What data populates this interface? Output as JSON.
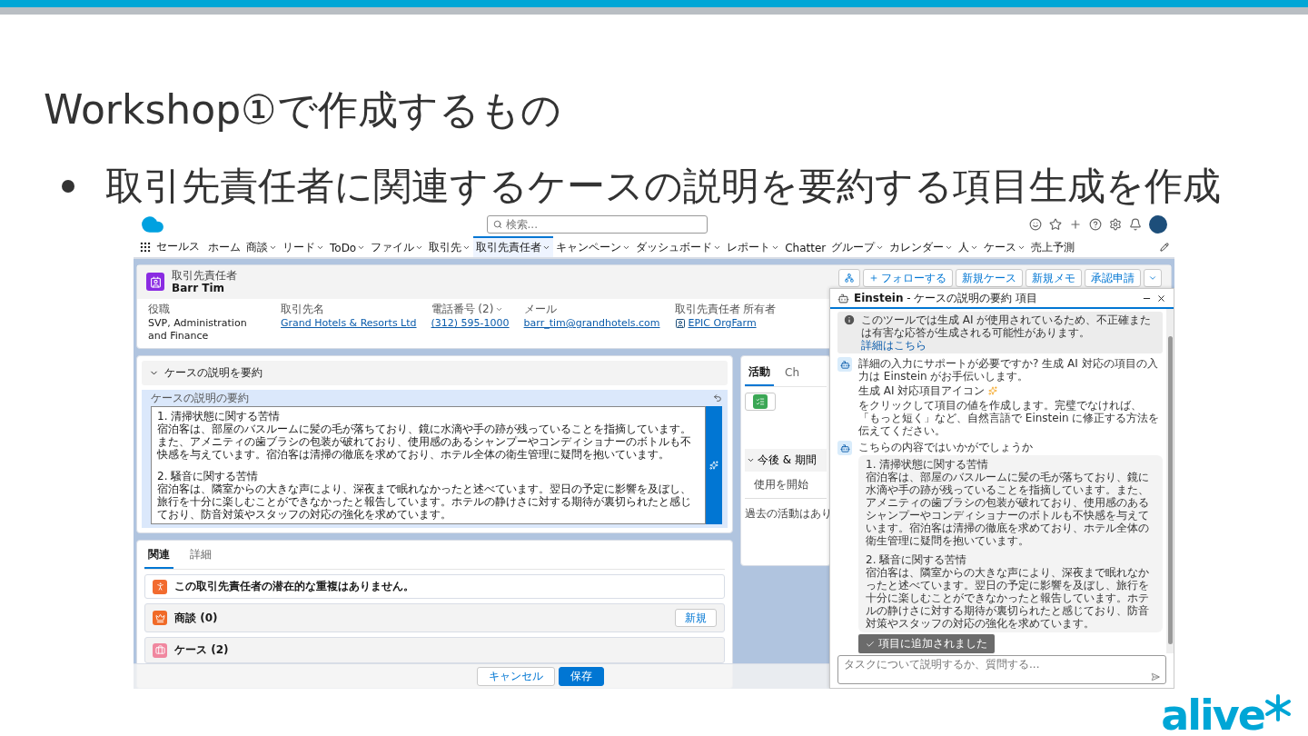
{
  "slide": {
    "title": "Workshop①で作成するもの",
    "bullets": [
      "取引先責任者に関連するケースの説明を要約する項目生成を作成"
    ],
    "logo": {
      "text": "alive"
    }
  },
  "app": {
    "search": {
      "placeholder": "検索..."
    },
    "app_name": "セールス",
    "nav": [
      {
        "label": "ホーム",
        "dropdown": false,
        "selected": false
      },
      {
        "label": "商談",
        "dropdown": true,
        "selected": false
      },
      {
        "label": "リード",
        "dropdown": true,
        "selected": false
      },
      {
        "label": "ToDo",
        "dropdown": true,
        "selected": false
      },
      {
        "label": "ファイル",
        "dropdown": true,
        "selected": false
      },
      {
        "label": "取引先",
        "dropdown": true,
        "selected": false
      },
      {
        "label": "取引先責任者",
        "dropdown": true,
        "selected": true
      },
      {
        "label": "キャンペーン",
        "dropdown": true,
        "selected": false
      },
      {
        "label": "ダッシュボード",
        "dropdown": true,
        "selected": false
      },
      {
        "label": "レポート",
        "dropdown": true,
        "selected": false
      },
      {
        "label": "Chatter",
        "dropdown": false,
        "selected": false
      },
      {
        "label": "グループ",
        "dropdown": true,
        "selected": false
      },
      {
        "label": "カレンダー",
        "dropdown": true,
        "selected": false
      },
      {
        "label": "人",
        "dropdown": true,
        "selected": false
      },
      {
        "label": "ケース",
        "dropdown": true,
        "selected": false
      },
      {
        "label": "売上予測",
        "dropdown": false,
        "selected": false
      }
    ],
    "record": {
      "type": "取引先責任者",
      "name": "Barr Tim",
      "follow": "フォローする",
      "actions": [
        "新規ケース",
        "新規メモ",
        "承認申請"
      ],
      "fields": [
        {
          "label": "役職",
          "value": "SVP, Administration and Finance",
          "kind": "text"
        },
        {
          "label": "取引先名",
          "value": "Grand Hotels & Resorts Ltd",
          "kind": "link"
        },
        {
          "label": "電話番号 (2)",
          "value": "(312) 595-1000",
          "kind": "phone"
        },
        {
          "label": "メール",
          "value": "barr_tim@grandhotels.com",
          "kind": "link"
        },
        {
          "label": "取引先責任者 所有者",
          "value": "EPIC OrgFarm",
          "kind": "owner"
        }
      ]
    },
    "summary_section": {
      "title": "ケースの説明を要約",
      "expanded": true,
      "field_label": "ケースの説明の要約",
      "paragraphs": [
        {
          "heading": "1. 清掃状態に関する苦情",
          "body": "宿泊客は、部屋のバスルームに髪の毛が落ちており、鏡に水滴や手の跡が残っていることを指摘しています。また、アメニティの歯ブラシの包装が破れており、使用感のあるシャンプーやコンディショナーのボトルも不快感を与えています。宿泊客は清掃の徹底を求めており、ホテル全体の衛生管理に疑問を抱いています。"
        },
        {
          "heading": "2. 騒音に関する苦情",
          "body": "宿泊客は、隣室からの大きな声により、深夜まで眠れなかったと述べています。翌日の予定に影響を及ぼし、旅行を十分に楽しむことができなかったと報告しています。ホテルの静けさに対する期待が裏切られたと感じており、防音対策やスタッフの対応の強化を求めています。"
        }
      ]
    },
    "related": {
      "tabs": [
        {
          "label": "関連",
          "selected": true
        },
        {
          "label": "詳細",
          "selected": false
        }
      ],
      "duplicate_notice": "この取引先責任者の潜在的な重複はありません。",
      "lists": [
        {
          "title": "商談 (0)",
          "button": "新規",
          "kind": "opportunity"
        },
        {
          "title": "ケース (2)",
          "kind": "case"
        }
      ]
    },
    "activity": {
      "tabs": [
        {
          "label": "活動",
          "selected": true
        },
        {
          "label": "Ch",
          "selected": false
        }
      ],
      "section": "今後 & 期間",
      "upcoming": "使用を開始",
      "past": "過去の活動はあり"
    },
    "footer": {
      "buttons": [
        {
          "label": "キャンセル",
          "kind": "neutral"
        },
        {
          "label": "保存",
          "kind": "brand"
        }
      ]
    },
    "einstein": {
      "title": "Einstein",
      "subtitle": " - ケースの説明の要約 項目",
      "notice": "このツールでは生成 AI が使用されているため、不正確または有害な応答が生成される可能性があります。",
      "notice_link": "詳細はこちら",
      "intro": "詳細の入力にサポートが必要ですか? 生成 AI 対応の項目の入力は Einstein がお手伝いします。",
      "hint_before": "生成 AI 対応項目アイコン",
      "hint_after": "をクリックして項目の値を作成します。完璧でなければ、「もっと短く」など、自然言語で Einstein に修正する方法を伝えてください。",
      "question": "こちらの内容ではいかがでしょうか",
      "answer": [
        {
          "heading": "1. 清掃状態に関する苦情",
          "body": "宿泊客は、部屋のバスルームに髪の毛が落ちており、鏡に水滴や手の跡が残っていることを指摘しています。また、アメニティの歯ブラシの包装が破れており、使用感のあるシャンプーやコンディショナーのボトルも不快感を与えています。宿泊客は清掃の徹底を求めており、ホテル全体の衛生管理に疑問を抱いています。"
        },
        {
          "heading": "2. 騒音に関する苦情",
          "body": "宿泊客は、隣室からの大きな声により、深夜まで眠れなかったと述べています。翌日の予定に影響を及ぼし、旅行を十分に楽しむことができなかったと報告しています。ホテルの静けさに対する期待が裏切られたと感じており、防音対策やスタッフの対応の強化を求めています。"
        }
      ],
      "added_label": "項目に追加されました",
      "input": {
        "placeholder": "タスクについて説明するか、質問する..."
      }
    }
  }
}
